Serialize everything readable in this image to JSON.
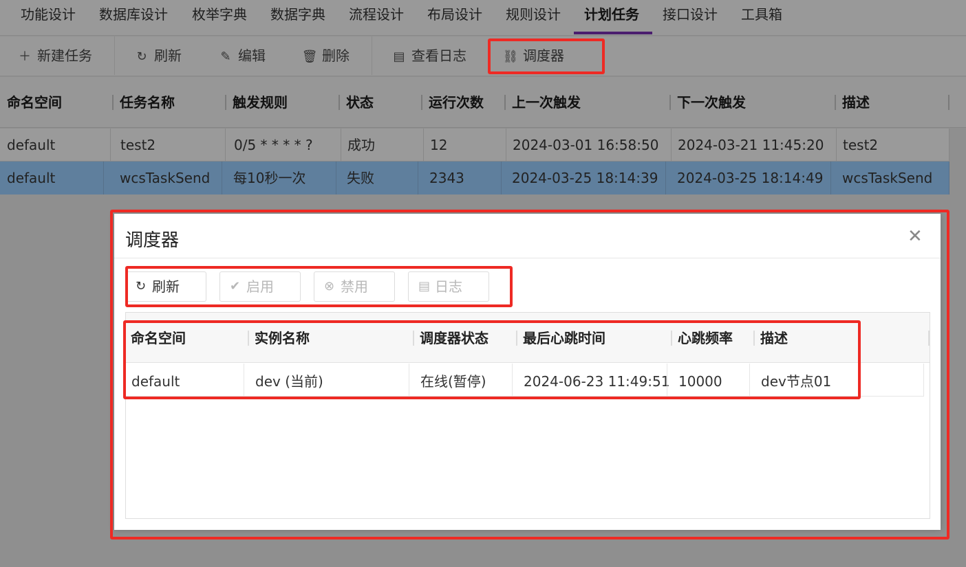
{
  "nav": {
    "tabs": [
      {
        "label": "功能设计"
      },
      {
        "label": "数据库设计"
      },
      {
        "label": "枚举字典"
      },
      {
        "label": "数据字典"
      },
      {
        "label": "流程设计"
      },
      {
        "label": "布局设计"
      },
      {
        "label": "规则设计"
      },
      {
        "label": "计划任务",
        "active": true
      },
      {
        "label": "接口设计"
      },
      {
        "label": "工具箱"
      }
    ]
  },
  "toolbar": {
    "new_task": {
      "label": "新建任务",
      "icon": "plus-icon"
    },
    "refresh": {
      "label": "刷新",
      "icon": "refresh-icon"
    },
    "edit": {
      "label": "编辑",
      "icon": "edit-icon"
    },
    "delete": {
      "label": "删除",
      "icon": "trash-icon"
    },
    "view_log": {
      "label": "查看日志",
      "icon": "document-icon"
    },
    "scheduler": {
      "label": "调度器",
      "icon": "scheduler-icon"
    }
  },
  "task_grid": {
    "columns": [
      "命名空间",
      "任务名称",
      "触发规则",
      "状态",
      "运行次数",
      "上一次触发",
      "下一次触发",
      "描述"
    ],
    "rows": [
      [
        "default",
        "test2",
        "0/5 * * * * ?",
        "成功",
        "12",
        "2024-03-01 16:58:50",
        "2024-03-21 11:45:20",
        "test2"
      ],
      [
        "default",
        "wcsTaskSend",
        "每10秒一次",
        "失败",
        "2343",
        "2024-03-25 18:14:39",
        "2024-03-25 18:14:49",
        "wcsTaskSend"
      ]
    ],
    "selected_row": 1
  },
  "modal": {
    "title": "调度器",
    "close_icon": "close-icon",
    "buttons": {
      "refresh": {
        "label": "刷新",
        "icon": "refresh-icon",
        "enabled": true
      },
      "enable": {
        "label": "启用",
        "icon": "check-circle-icon",
        "enabled": false
      },
      "disable": {
        "label": "禁用",
        "icon": "x-circle-icon",
        "enabled": false
      },
      "log": {
        "label": "日志",
        "icon": "document-icon",
        "enabled": false
      }
    },
    "table": {
      "columns": [
        "命名空间",
        "实例名称",
        "调度器状态",
        "最后心跳时间",
        "心跳频率",
        "描述"
      ],
      "rows": [
        [
          "default",
          "dev (当前)",
          "在线(暂停)",
          "2024-06-23 11:49:51",
          "10000",
          "dev节点01"
        ]
      ]
    }
  },
  "colors": {
    "highlight": "#ee2a24",
    "active_tab_underline": "#4b1e6e",
    "selected_row": "#5f7f9d",
    "overlay": "#999999"
  }
}
